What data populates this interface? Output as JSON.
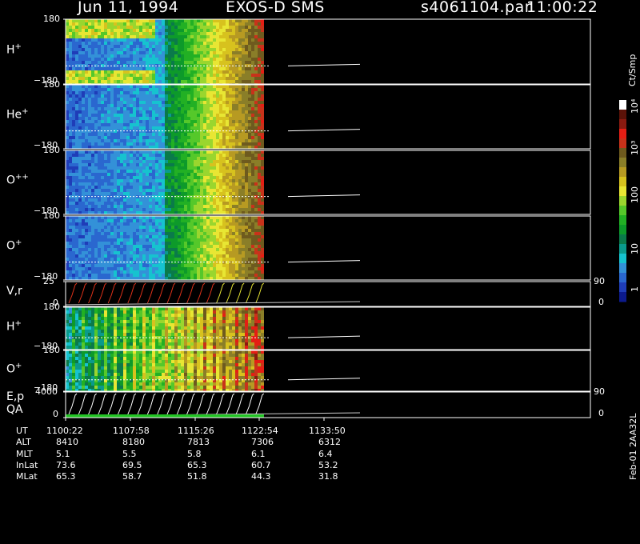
{
  "header": {
    "date": "Jun 11, 1994",
    "instrument": "EXOS-D SMS",
    "file": "s4061104.par",
    "time": "11:00:22"
  },
  "panels": [
    {
      "id": "h1",
      "label": "H",
      "sup": "+",
      "top_tick": "180",
      "bottom_tick": "−180",
      "kind": "spectrogram"
    },
    {
      "id": "he",
      "label": "He",
      "sup": "+",
      "top_tick": "180",
      "bottom_tick": "−180",
      "kind": "spectrogram"
    },
    {
      "id": "opp",
      "label": "O",
      "sup": "++",
      "top_tick": "180",
      "bottom_tick": "−180",
      "kind": "spectrogram"
    },
    {
      "id": "op1",
      "label": "O",
      "sup": "+",
      "top_tick": "180",
      "bottom_tick": "−180",
      "kind": "spectrogram"
    },
    {
      "id": "vr",
      "label": "V,r",
      "sup": "",
      "top_tick": "25",
      "bottom_tick": "0",
      "right_top": "90",
      "right_bottom": "0",
      "kind": "line"
    },
    {
      "id": "h2",
      "label": "H",
      "sup": "+",
      "top_tick": "180",
      "bottom_tick": "−180",
      "kind": "spectrogram"
    },
    {
      "id": "op2",
      "label": "O",
      "sup": "+",
      "top_tick": "180",
      "bottom_tick": "−180",
      "kind": "spectrogram"
    },
    {
      "id": "ep",
      "label": "E,p",
      "sup": "",
      "label2": "QA",
      "top_tick": "4000",
      "bottom_tick": "0",
      "right_top": "90",
      "right_bottom": "0",
      "kind": "line"
    }
  ],
  "colorbar": {
    "unit": "Ct/Smp",
    "ticks": [
      "1",
      "10",
      "100",
      "10³",
      "10⁴"
    ],
    "colors": [
      "#0c1a8c",
      "#1f3db8",
      "#2a67cf",
      "#3391d8",
      "#16c3cf",
      "#0a9a8c",
      "#0a7a4a",
      "#0d9a2a",
      "#22b024",
      "#55c82a",
      "#9ad62e",
      "#e8e633",
      "#d7c21e",
      "#b79a22",
      "#8a7e28",
      "#6e5a1e",
      "#c8321a",
      "#e41e14",
      "#8a1a10",
      "#5a1208",
      "#ffffff"
    ]
  },
  "chart_data": {
    "type": "heatmap",
    "title": "Jun 11, 1994   EXOS-D SMS",
    "xlabel": "UT",
    "x_ticks": [
      "1100:22",
      "1107:58",
      "1115:26",
      "1122:54",
      "1133:50"
    ],
    "ephemeris": [
      {
        "name": "UT",
        "values": [
          "1100:22",
          "1107:58",
          "1115:26",
          "1122:54",
          "1133:50"
        ]
      },
      {
        "name": "ALT",
        "values": [
          "8410",
          "8180",
          "7813",
          "7306",
          "6312"
        ]
      },
      {
        "name": "MLT",
        "values": [
          "5.1",
          "5.5",
          "5.8",
          "6.1",
          "6.4"
        ]
      },
      {
        "name": "InLat",
        "values": [
          "73.6",
          "69.5",
          "65.3",
          "60.7",
          "53.2"
        ]
      },
      {
        "name": "MLat",
        "values": [
          "65.3",
          "58.7",
          "51.8",
          "44.3",
          "31.8"
        ]
      }
    ],
    "colorscale": {
      "unit": "Ct/Smp",
      "log": true,
      "range": [
        1,
        10000
      ]
    }
  },
  "caption": "Feb-01 2AA32L"
}
